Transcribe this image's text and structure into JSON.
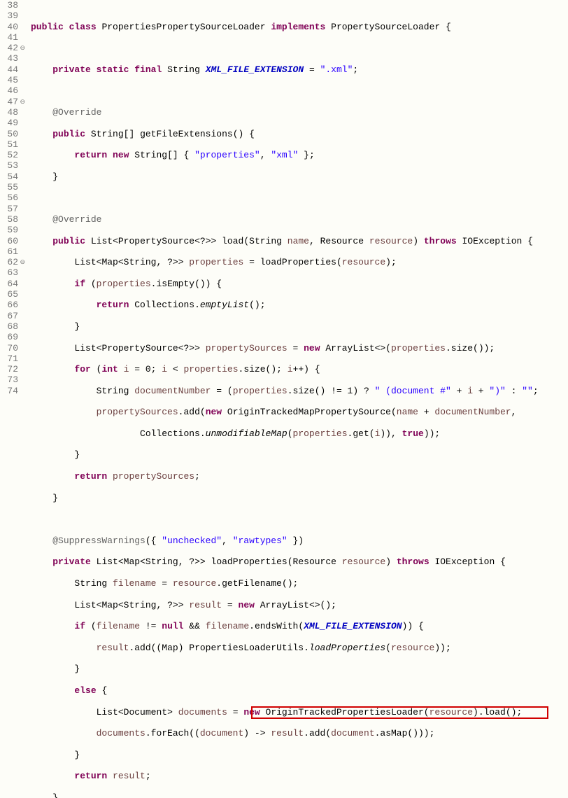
{
  "gutter": {
    "start": 38,
    "end": 74,
    "fold_lines": [
      42,
      47,
      62
    ]
  },
  "kw": {
    "public": "public",
    "class": "class",
    "implements": "implements",
    "private": "private",
    "static": "static",
    "final": "final",
    "return": "return",
    "new": "new",
    "if": "if",
    "else": "else",
    "for": "for",
    "int": "int",
    "throws": "throws",
    "null": "null",
    "true": "true"
  },
  "id": {
    "ClassName": "PropertiesPropertySourceLoader",
    "Iface": "PropertySourceLoader",
    "String": "String",
    "List": "List",
    "Map": "Map",
    "PropertySource": "PropertySource",
    "Resource": "Resource",
    "IOException": "IOException",
    "Collections": "Collections",
    "ArrayList": "ArrayList",
    "OriginTrackedMapPropertySource": "OriginTrackedMapPropertySource",
    "PropertiesLoaderUtils": "PropertiesLoaderUtils",
    "Document": "Document",
    "OriginTrackedPropertiesLoader": "OriginTrackedPropertiesLoader"
  },
  "const": {
    "XML_FILE_EXTENSION": "XML_FILE_EXTENSION"
  },
  "str": {
    "xml_ext": "\".xml\"",
    "properties": "\"properties\"",
    "xml": "\"xml\"",
    "doc_pre": "\" (document #\"",
    "doc_suf": "\")\"",
    "empty": "\"\"",
    "unchecked": "\"unchecked\"",
    "rawtypes": "\"rawtypes\""
  },
  "ann": {
    "Override": "@Override",
    "SuppressWarnings": "@SuppressWarnings"
  },
  "mth": {
    "getFileExtensions": "getFileExtensions",
    "load": "load",
    "loadProperties": "loadProperties",
    "isEmpty": "isEmpty",
    "emptyList": "emptyList",
    "size": "size",
    "add": "add",
    "unmodifiableMap": "unmodifiableMap",
    "get": "get",
    "getFilename": "getFilename",
    "endsWith": "endsWith",
    "loadPropertiesStatic": "loadProperties",
    "forEach": "forEach",
    "asMap": "asMap"
  },
  "var": {
    "name": "name",
    "resource": "resource",
    "properties": "properties",
    "propertySources": "propertySources",
    "i": "i",
    "documentNumber": "documentNumber",
    "filename": "filename",
    "result": "result",
    "documents": "documents",
    "document": "document"
  },
  "highlight_line": 70
}
